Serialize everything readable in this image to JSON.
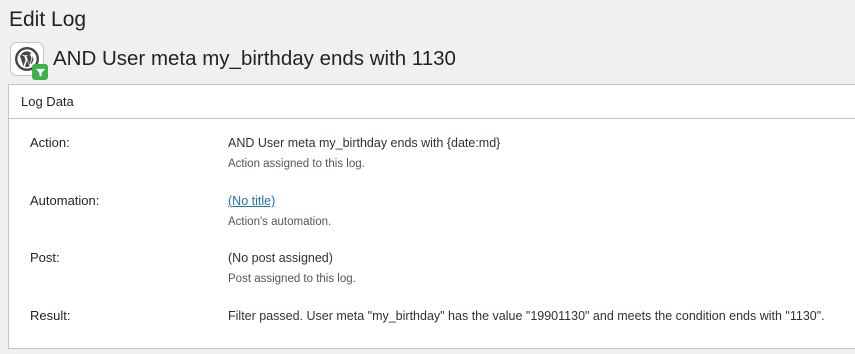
{
  "page": {
    "heading": "Edit Log",
    "log_title": "AND User meta my_birthday ends with 1130"
  },
  "icons": {
    "integration": "wordpress-logo-icon",
    "badge": "filter-icon",
    "badge_color": "#3bb34a"
  },
  "panel": {
    "title": "Log Data",
    "rows": [
      {
        "label": "Action:",
        "value": "AND User meta my_birthday ends with {date:md}",
        "description": "Action assigned to this log."
      },
      {
        "label": "Automation:",
        "value": "(No title)",
        "description": "Action's automation."
      },
      {
        "label": "Post:",
        "value": "(No post assigned)",
        "description": "Post assigned to this log."
      },
      {
        "label": "Result:",
        "value": "Filter passed. User meta \"my_birthday\" has the value \"19901130\" and meets the condition ends with \"1130\".",
        "description": ""
      }
    ]
  },
  "colors": {
    "link": "#2271b1",
    "background": "#f0f0f1"
  }
}
